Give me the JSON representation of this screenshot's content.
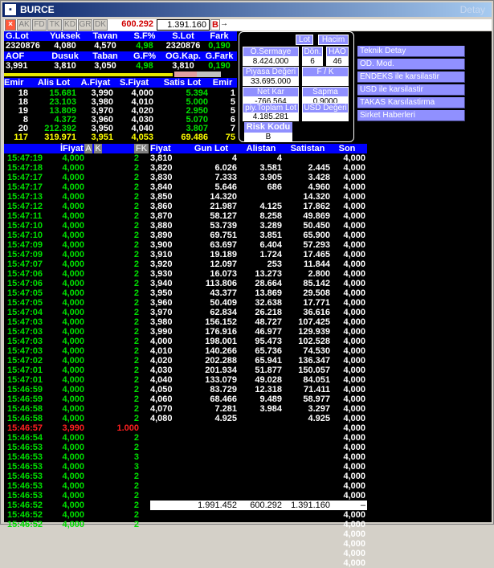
{
  "window": {
    "title": "BURCE",
    "title_right": "Detay"
  },
  "toolbar": {
    "buttons": [
      "AK",
      "FD",
      "TK",
      "KD",
      "GR",
      "DK"
    ],
    "price1": "600.292",
    "price2": "1.391.160",
    "flag": "B",
    "arrow": "→"
  },
  "stats": {
    "h1": [
      "G.Lot",
      "Yuksek",
      "Tavan",
      "S.F%",
      "S.Lot",
      "Fark"
    ],
    "v1": [
      "2320876",
      "4,080",
      "4,570",
      "4,98",
      "2320876",
      "0,190"
    ],
    "h2": [
      "AOF",
      "Dusuk",
      "Taban",
      "G.F%",
      "OG.Kap.",
      "G.Fark"
    ],
    "v2": [
      "3,991",
      "3,810",
      "3,050",
      "4,98",
      "3,810",
      "0,190"
    ]
  },
  "orderbook": {
    "headers": [
      "Emir",
      "Alis Lot",
      "A.Fiyat",
      "S.Fiyat",
      "Satis Lot",
      "Emir"
    ],
    "rows": [
      [
        "18",
        "15.681",
        "3,990",
        "4,000",
        "5.394",
        "1"
      ],
      [
        "18",
        "23.103",
        "3,980",
        "4,010",
        "5.000",
        "5"
      ],
      [
        "19",
        "13.809",
        "3,970",
        "4,020",
        "2.950",
        "5"
      ],
      [
        "8",
        "4.372",
        "3,960",
        "4,030",
        "5.070",
        "6"
      ],
      [
        "20",
        "212.392",
        "3,950",
        "4,040",
        "3.807",
        "7"
      ]
    ],
    "totals": [
      "117",
      "319.971",
      "3,951",
      "4,053",
      "69.486",
      "75"
    ]
  },
  "panel": {
    "lot_btn": "Lot",
    "hacim_btn": "Hacim",
    "sermaye_label": "Ö.Sermaye",
    "sermaye_val": "8.424.000",
    "don_label": "Dön.",
    "don_val": "6",
    "hao_label": "HAO",
    "hao_val": "46",
    "piyasa_label": "Piyasa Değeri",
    "piyasa_val": "33.695.000",
    "fk_label": "F / K",
    "fk_val": "",
    "netkar_label": "Net Kar",
    "netkar_val": "-766.564",
    "sapma_label": "Sapma",
    "sapma_val": "0,9000",
    "piytoplam_label": "piy.Toplam Lot",
    "piytoplam_val": "4.185.281",
    "usd_label": "USD Değeri",
    "usd_val": "",
    "risk_label": "Risk Kodu",
    "risk_val": "B"
  },
  "menu": [
    "Teknik Detay",
    "OD. Mod.",
    "ENDEKS ile karsilastir",
    "USD ile karsilastir",
    "TAKAS Karsılastirma",
    "Sirket Haberleri"
  ],
  "timesales": {
    "headers": {
      "time": "",
      "price": "İFiyat",
      "a": "A",
      "k": "K",
      "lot": "",
      "fk": "FK"
    },
    "rows": [
      [
        "15:47:19",
        "4,000",
        "2",
        "g"
      ],
      [
        "15:47:18",
        "4,000",
        "2",
        "g"
      ],
      [
        "15:47:17",
        "4,000",
        "2",
        "g"
      ],
      [
        "15:47:17",
        "4,000",
        "2",
        "g"
      ],
      [
        "15:47:13",
        "4,000",
        "2",
        "g"
      ],
      [
        "15:47:12",
        "4,000",
        "2",
        "g"
      ],
      [
        "15:47:11",
        "4,000",
        "2",
        "g"
      ],
      [
        "15:47:10",
        "4,000",
        "2",
        "g"
      ],
      [
        "15:47:10",
        "4,000",
        "2",
        "g"
      ],
      [
        "15:47:09",
        "4,000",
        "2",
        "g"
      ],
      [
        "15:47:09",
        "4,000",
        "2",
        "g"
      ],
      [
        "15:47:07",
        "4,000",
        "2",
        "g"
      ],
      [
        "15:47:06",
        "4,000",
        "2",
        "g"
      ],
      [
        "15:47:06",
        "4,000",
        "2",
        "g"
      ],
      [
        "15:47:05",
        "4,000",
        "2",
        "g"
      ],
      [
        "15:47:05",
        "4,000",
        "2",
        "g"
      ],
      [
        "15:47:04",
        "4,000",
        "2",
        "g"
      ],
      [
        "15:47:03",
        "4,000",
        "2",
        "g"
      ],
      [
        "15:47:03",
        "4,000",
        "2",
        "g"
      ],
      [
        "15:47:03",
        "4,000",
        "2",
        "g"
      ],
      [
        "15:47:03",
        "4,000",
        "2",
        "g"
      ],
      [
        "15:47:02",
        "4,000",
        "2",
        "g"
      ],
      [
        "15:47:01",
        "4,000",
        "2",
        "g"
      ],
      [
        "15:47:01",
        "4,000",
        "2",
        "g"
      ],
      [
        "15:46:59",
        "4,000",
        "2",
        "g"
      ],
      [
        "15:46:59",
        "4,000",
        "2",
        "g"
      ],
      [
        "15:46:58",
        "4,000",
        "2",
        "g"
      ],
      [
        "15:46:58",
        "4,000",
        "2",
        "g"
      ],
      [
        "15:46:57",
        "3,990",
        "1.000",
        "r"
      ],
      [
        "15:46:54",
        "4,000",
        "2",
        "g"
      ],
      [
        "15:46:53",
        "4,000",
        "2",
        "g"
      ],
      [
        "15:46:53",
        "4,000",
        "3",
        "g"
      ],
      [
        "15:46:53",
        "4,000",
        "3",
        "g"
      ],
      [
        "15:46:53",
        "4,000",
        "2",
        "g"
      ],
      [
        "15:46:53",
        "4,000",
        "2",
        "g"
      ],
      [
        "15:46:53",
        "4,000",
        "2",
        "g"
      ],
      [
        "15:46:52",
        "4,000",
        "2",
        "g"
      ],
      [
        "15:46:52",
        "4,000",
        "2",
        "g"
      ],
      [
        "15:46:52",
        "4,000",
        "2",
        "g"
      ]
    ]
  },
  "depth": {
    "headers": [
      "Fiyat",
      "Gun Lot",
      "Alistan",
      "Satistan",
      "Son"
    ],
    "rows": [
      [
        "3,810",
        "4",
        "4",
        "",
        "4,000"
      ],
      [
        "3,820",
        "6.026",
        "3.581",
        "2.445",
        "4,000"
      ],
      [
        "3,830",
        "7.333",
        "3.905",
        "3.428",
        "4,000"
      ],
      [
        "3,840",
        "5.646",
        "686",
        "4.960",
        "4,000"
      ],
      [
        "3,850",
        "14.320",
        "",
        "14.320",
        "4,000"
      ],
      [
        "3,860",
        "21.987",
        "4.125",
        "17.862",
        "4,000"
      ],
      [
        "3,870",
        "58.127",
        "8.258",
        "49.869",
        "4,000"
      ],
      [
        "3,880",
        "53.739",
        "3.289",
        "50.450",
        "4,000"
      ],
      [
        "3,890",
        "69.751",
        "3.851",
        "65.900",
        "4,000"
      ],
      [
        "3,900",
        "63.697",
        "6.404",
        "57.293",
        "4,000"
      ],
      [
        "3,910",
        "19.189",
        "1.724",
        "17.465",
        "4,000"
      ],
      [
        "3,920",
        "12.097",
        "253",
        "11.844",
        "4,000"
      ],
      [
        "3,930",
        "16.073",
        "13.273",
        "2.800",
        "4,000"
      ],
      [
        "3,940",
        "113.806",
        "28.664",
        "85.142",
        "4,000"
      ],
      [
        "3,950",
        "43.377",
        "13.869",
        "29.508",
        "4,000"
      ],
      [
        "3,960",
        "50.409",
        "32.638",
        "17.771",
        "4,000"
      ],
      [
        "3,970",
        "62.834",
        "26.218",
        "36.616",
        "4,000"
      ],
      [
        "3,980",
        "156.152",
        "48.727",
        "107.425",
        "4,000"
      ],
      [
        "3,990",
        "176.916",
        "46.977",
        "129.939",
        "4,000"
      ],
      [
        "4,000",
        "198.001",
        "95.473",
        "102.528",
        "4,000"
      ],
      [
        "4,010",
        "140.266",
        "65.736",
        "74.530",
        "4,000"
      ],
      [
        "4,020",
        "202.288",
        "65.941",
        "136.347",
        "4,000"
      ],
      [
        "4,030",
        "201.934",
        "51.877",
        "150.057",
        "4,000"
      ],
      [
        "4,040",
        "133.079",
        "49.028",
        "84.051",
        "4,000"
      ],
      [
        "4,050",
        "83.729",
        "12.318",
        "71.411",
        "4,000"
      ],
      [
        "4,060",
        "68.466",
        "9.489",
        "58.977",
        "4,000"
      ],
      [
        "4,070",
        "7.281",
        "3.984",
        "3.297",
        "4,000"
      ],
      [
        "4,080",
        "4.925",
        "",
        "4.925",
        "4,000"
      ]
    ],
    "son_extra": [
      "4,000",
      "4,000",
      "4,000",
      "4,000",
      "4,000",
      "4,000",
      "4,000",
      "4,000"
    ],
    "totals": [
      "1.991.452",
      "600.292",
      "1.391.160",
      "–"
    ],
    "after_totals": [
      "4,000",
      "4,000",
      "4,000",
      "4,000",
      "4,000",
      "4,000"
    ]
  },
  "colors": {
    "green": "#00e000",
    "red": "#ff2020",
    "yellow": "#ffff00",
    "panel_blue": "#9090ff",
    "header_blue": "#0000ff"
  }
}
